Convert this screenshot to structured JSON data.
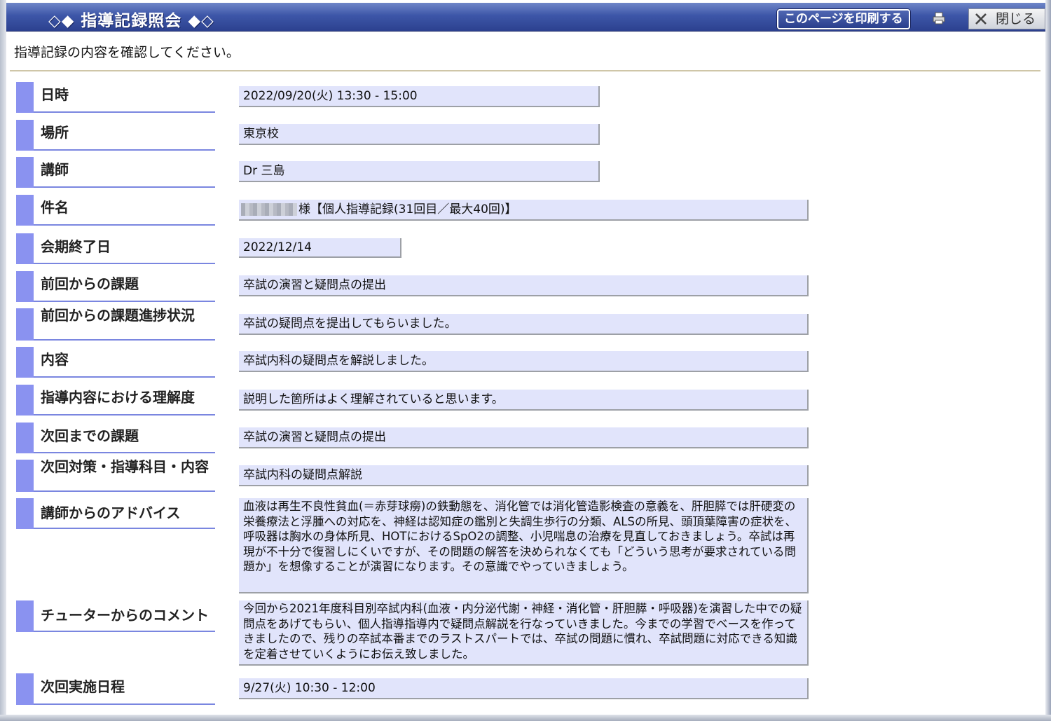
{
  "window": {
    "title": "◇◆ 指導記録照会 ◆◇",
    "print_label": "このページを印刷する",
    "close_label": "閉じる"
  },
  "instruction": "指導記録の内容を確認してください。",
  "fields": [
    {
      "label": "日時",
      "value": "2022/09/20(火) 13:30 - 15:00"
    },
    {
      "label": "場所",
      "value": "東京校"
    },
    {
      "label": "講師",
      "value": "Dr 三島"
    },
    {
      "label": "件名",
      "value": "様【個人指導記録(31回目／最大40回)】"
    },
    {
      "label": "会期終了日",
      "value": "2022/12/14"
    },
    {
      "label": "前回からの課題",
      "value": "卒試の演習と疑問点の提出"
    },
    {
      "label": "前回からの課題進捗状況",
      "value": "卒試の疑問点を提出してもらいました。"
    },
    {
      "label": "内容",
      "value": "卒試内科の疑問点を解説しました。"
    },
    {
      "label": "指導内容における理解度",
      "value": "説明した箇所はよく理解されていると思います。"
    },
    {
      "label": "次回までの課題",
      "value": "卒試の演習と疑問点の提出"
    },
    {
      "label": "次回対策・指導科目・内容",
      "value": "卒試内科の疑問点解説"
    },
    {
      "label": "講師からのアドバイス",
      "value": "血液は再生不良性貧血(＝赤芽球癆)の鉄動態を、消化管では消化管造影検査の意義を、肝胆膵では肝硬変の栄養療法と浮腫への対応を、神経は認知症の鑑別と失調生歩行の分類、ALSの所見、頭頂葉障害の症状を、呼吸器は胸水の身体所見、HOTにおけるSpO2の調整、小児喘息の治療を見直しておきましょう。卒試は再現が不十分で復習しにくいですが、その問題の解答を決められなくても「どういう思考が要求されている問題か」を想像することが演習になります。その意識でやっていきましょう。"
    },
    {
      "label": "チューターからのコメント",
      "value": "今回から2021年度科目別卒試内科(血液・内分泌代謝・神経・消化管・肝胆膵・呼吸器)を演習した中での疑問点をあげてもらい、個人指導指導内で疑問点解説を行なっていきました。今までの学習でベースを作ってきましたので、残りの卒試本番までのラストスパートでは、卒試の問題に慣れ、卒試問題に対応できる知識を定着させていくようにお伝え致しました。"
    },
    {
      "label": "次回実施日程",
      "value": "9/27(火) 10:30 - 12:00"
    }
  ]
}
